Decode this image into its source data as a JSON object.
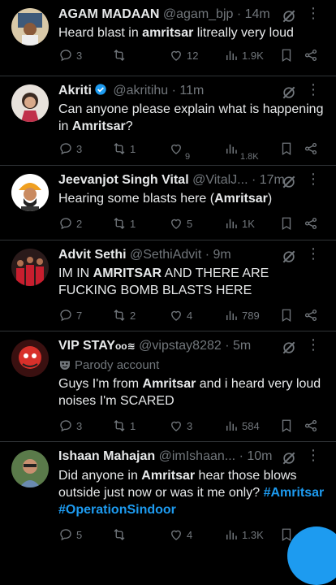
{
  "colors": {
    "background": "#000000",
    "text": "#e7e9ea",
    "muted": "#71767b",
    "accent": "#1d9bf0"
  },
  "tweets": [
    {
      "name": "AGAM MADAAN",
      "handle": "@agam_bjp",
      "time": "· 14m",
      "text_parts": [
        "Heard blast in ",
        "amritsar",
        " litreally very loud"
      ],
      "replies": "3",
      "retweets": "",
      "likes": "12",
      "views": "1.9K"
    },
    {
      "name": "Akriti",
      "handle": "@akritihu",
      "time": "· 11m",
      "verified": true,
      "text_parts": [
        "Can anyone please explain what is happening in ",
        "Amritsar",
        "?"
      ],
      "replies": "3",
      "retweets": "1",
      "likes": "9",
      "views": "1.8K"
    },
    {
      "name": "Jeevanjot Singh Vital",
      "handle": "@VitalJ...",
      "time": "· 17m",
      "text_parts": [
        "Hearing some blasts here (",
        "Amritsar",
        ")"
      ],
      "replies": "2",
      "retweets": "1",
      "likes": "5",
      "views": "1K"
    },
    {
      "name": "Advit Sethi",
      "handle": "@SethiAdvit",
      "time": "· 9m",
      "text_parts": [
        "IM IN ",
        "AMRITSAR",
        " AND THERE ARE FUCKING BOMB BLASTS HERE"
      ],
      "replies": "7",
      "retweets": "2",
      "likes": "4",
      "views": "789"
    },
    {
      "name": "VIP STAY",
      "name_suffix": "ᴏᴏ≋",
      "handle": "@vipstay8282",
      "time": "· 5m",
      "parody": "Parody account",
      "text_parts": [
        "Guys I'm from ",
        "Amritsar",
        " and i heard very loud noises I'm SCARED"
      ],
      "replies": "3",
      "retweets": "1",
      "likes": "3",
      "views": "584"
    },
    {
      "name": "Ishaan Mahajan",
      "handle": "@imIshaan...",
      "time": "· 10m",
      "text_parts": [
        "Did anyone in ",
        "Amritsar",
        " hear those blows outside just now or was it me only? "
      ],
      "hashtags": [
        "#Amritsar",
        "#OperationSindoor"
      ],
      "replies": "5",
      "retweets": "",
      "likes": "4",
      "views": "1.3K"
    }
  ],
  "icons": [
    "reply-icon",
    "retweet-icon",
    "like-icon",
    "views-icon",
    "bookmark-icon",
    "share-icon",
    "grok-icon",
    "more-icon",
    "verified-badge-icon",
    "parody-mask-icon"
  ]
}
